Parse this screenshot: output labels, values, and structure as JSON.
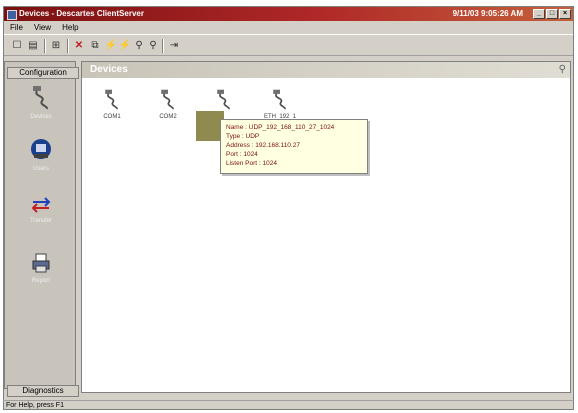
{
  "window": {
    "title": "Devices - Descartes ClientServer",
    "time": "9/11/03 9:05:26 AM",
    "controls": [
      "_",
      "□",
      "×"
    ]
  },
  "menu": [
    "File",
    "View",
    "Help"
  ],
  "toolbar": {
    "icons": [
      "new-icon",
      "save-icon",
      "tree-icon",
      "delete-icon",
      "properties-icon",
      "connect-icon",
      "disconnect-icon",
      "zoom-in-icon",
      "zoom-out-icon",
      "exit-icon"
    ]
  },
  "sidebar": {
    "header": "Configuration",
    "footer": "Diagnostics",
    "items": [
      {
        "label": "Devices",
        "icon": "serial-cable-icon"
      },
      {
        "label": "Users",
        "icon": "user-monitor-icon"
      },
      {
        "label": "Transfer",
        "icon": "transfer-arrows-icon"
      },
      {
        "label": "Report",
        "icon": "report-printer-icon"
      }
    ]
  },
  "content": {
    "title": "Devices",
    "devices": [
      {
        "label": "COM1"
      },
      {
        "label": "COM2"
      },
      {
        "label": ""
      },
      {
        "label": "ETH_192_1"
      }
    ]
  },
  "tooltip": {
    "lines": [
      "Name : UDP_192_168_110_27_1024",
      "Type : UDP",
      "Address : 192.168.110.27",
      "Port : 1024",
      "Listen Port : 1024"
    ]
  },
  "status": "For Help, press F1"
}
